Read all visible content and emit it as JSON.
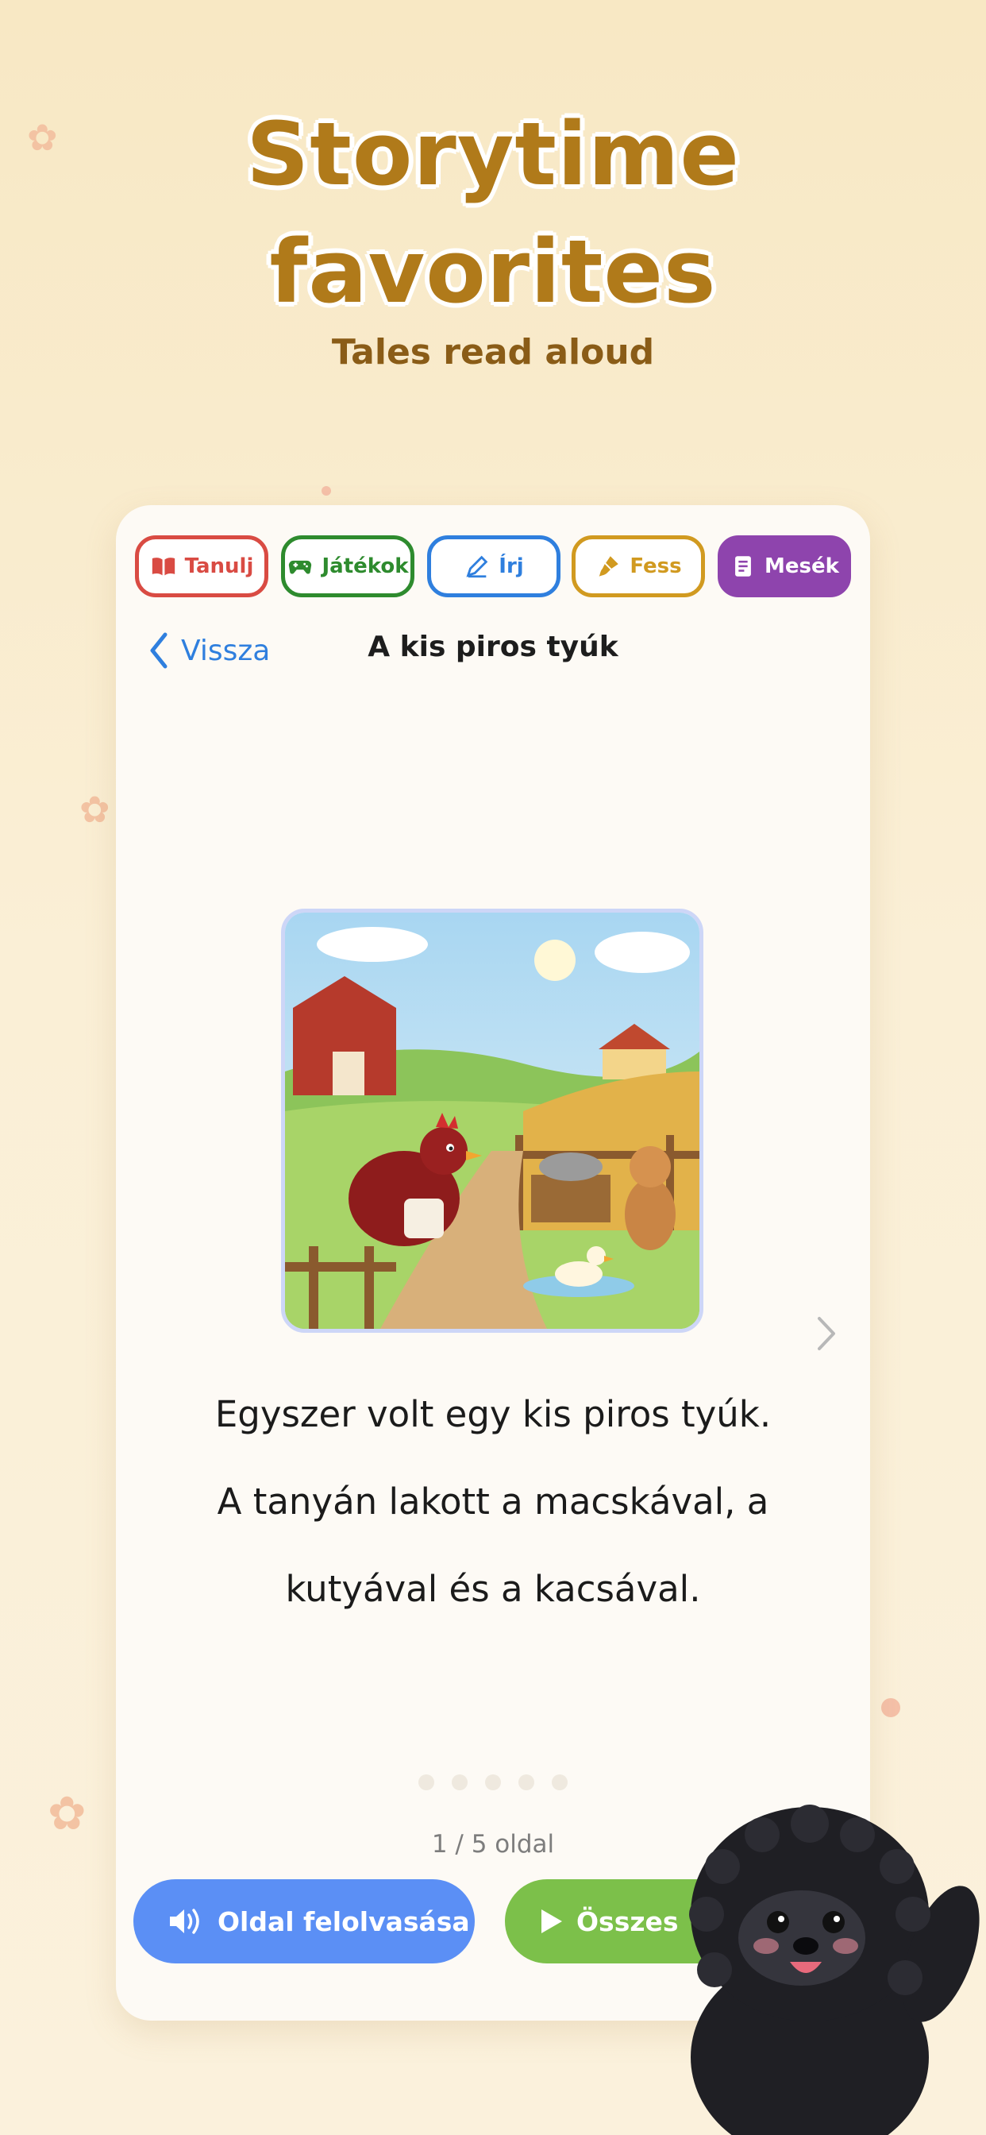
{
  "hero": {
    "title_line1": "Storytime",
    "title_line2": "favorites",
    "subtitle": "Tales read aloud"
  },
  "tabs": [
    {
      "label": "Tanulj",
      "icon": "book-icon",
      "color": "#d94b43"
    },
    {
      "label": "Játékok",
      "icon": "gamepad-icon",
      "color": "#2e8b2e"
    },
    {
      "label": "Írj",
      "icon": "pencil-icon",
      "color": "#2f7fde"
    },
    {
      "label": "Fess",
      "icon": "paintbrush-icon",
      "color": "#d19a20"
    },
    {
      "label": "Mesék",
      "icon": "storybook-icon",
      "color": "#8e44ad",
      "active": true
    }
  ],
  "nav": {
    "back_label": "Vissza",
    "page_title": "A kis piros tyúk"
  },
  "story": {
    "illustration": "red-hen-farm-illustration",
    "lines": [
      "Egyszer volt egy kis piros tyúk.",
      "A tanyán lakott a macskával, a",
      "kutyával és a kacsával."
    ]
  },
  "pager": {
    "indicator": "1 / 5 oldal",
    "total_pages": 5,
    "current_page": 1
  },
  "actions": {
    "read_page_label": "Oldal felolvasása",
    "read_page_color": "#5b8ff5",
    "read_all_label": "Összes",
    "read_all_color": "#7cc04a"
  },
  "mascot": "black-puli-dog-waving"
}
